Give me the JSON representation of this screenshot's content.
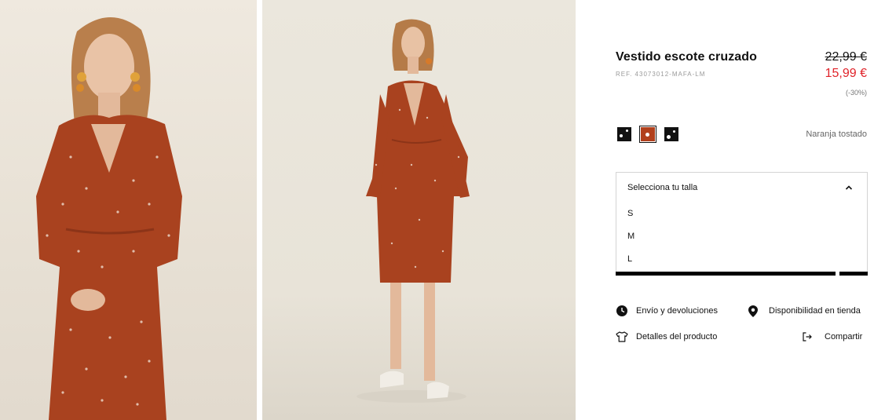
{
  "product": {
    "title": "Vestido escote cruzado",
    "ref": "REF. 43073012-MAFA-LM",
    "price_old": "22,99 €",
    "price_new": "15,99 €",
    "discount": "(-30%)"
  },
  "colors": {
    "selected_name": "Naranja tostado",
    "swatches": [
      {
        "name": "black-dots",
        "color": "#111111"
      },
      {
        "name": "naranja-tostado",
        "color": "#b2401c"
      },
      {
        "name": "black-dots-2",
        "color": "#111111"
      }
    ]
  },
  "size_selector": {
    "label": "Selecciona tu talla",
    "options": [
      "S",
      "M",
      "L"
    ]
  },
  "links": {
    "shipping": "Envío y devoluciones",
    "availability": "Disponibilidad en tienda",
    "details": "Detalles del producto",
    "share": "Compartir"
  },
  "icons": {
    "shipping": "clock-icon",
    "availability": "location-pin-icon",
    "details": "tshirt-icon",
    "share": "share-icon",
    "size_toggle": "chevron-up-icon"
  },
  "theme": {
    "sale_red": "#e0232a",
    "dress_rust": "#b2401c",
    "text": "#111111"
  }
}
